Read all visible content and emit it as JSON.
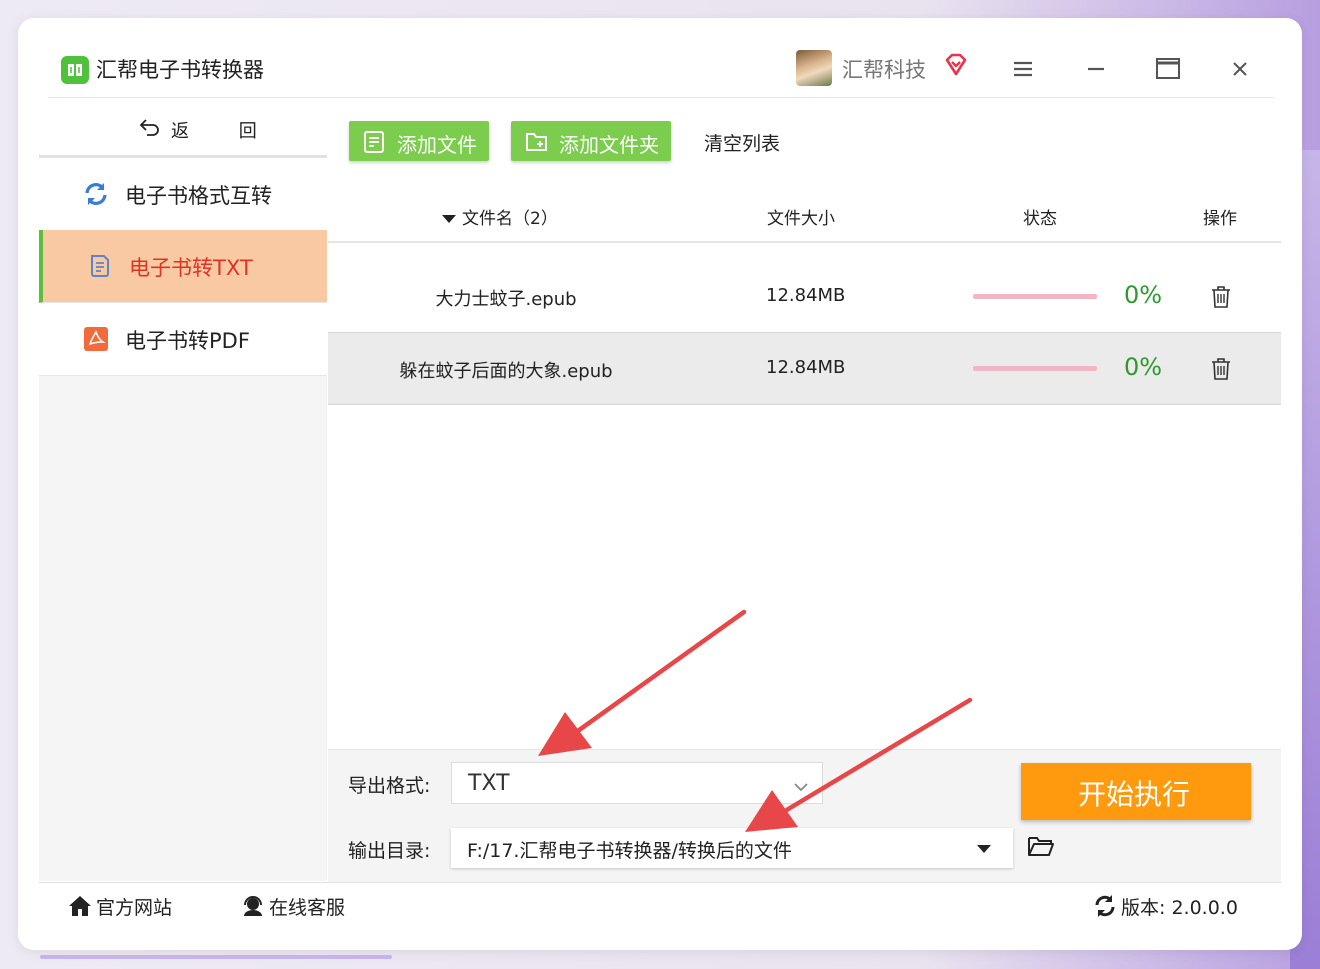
{
  "app": {
    "title": "汇帮电子书转换器"
  },
  "user": {
    "name": "汇帮科技"
  },
  "window_controls": [
    "menu-icon",
    "minimize-icon",
    "maximize-icon",
    "close-icon"
  ],
  "sidebar": {
    "back_label": "返 回",
    "items": [
      {
        "label": "电子书格式互转",
        "icon": "refresh-icon",
        "active": false
      },
      {
        "label": "电子书转TXT",
        "icon": "document-icon",
        "active": true
      },
      {
        "label": "电子书转PDF",
        "icon": "pdf-icon",
        "active": false
      }
    ]
  },
  "toolbar": {
    "add_file": "添加文件",
    "add_folder": "添加文件夹",
    "clear_list": "清空列表"
  },
  "table": {
    "headers": {
      "name": "文件名（2）",
      "size": "文件大小",
      "status": "状态",
      "action": "操作"
    },
    "rows": [
      {
        "name": "大力士蚊子.epub",
        "size": "12.84MB",
        "progress": "0%"
      },
      {
        "name": "躲在蚊子后面的大象.epub",
        "size": "12.84MB",
        "progress": "0%"
      }
    ]
  },
  "settings": {
    "format_label": "导出格式:",
    "format_value": "TXT",
    "dir_label": "输出目录:",
    "dir_value": "F:/17.汇帮电子书转换器/转换后的文件"
  },
  "start_button": "开始执行",
  "footer": {
    "website": "官方网站",
    "support": "在线客服",
    "version": "版本: 2.0.0.0"
  },
  "colors": {
    "accent_green": "#7ccd4e",
    "active_bg": "#f8c9a3",
    "active_text": "#e0331f",
    "start_orange": "#ff9a0f",
    "percent_green": "#2e9a2e",
    "annotation_red": "#e8474a"
  }
}
